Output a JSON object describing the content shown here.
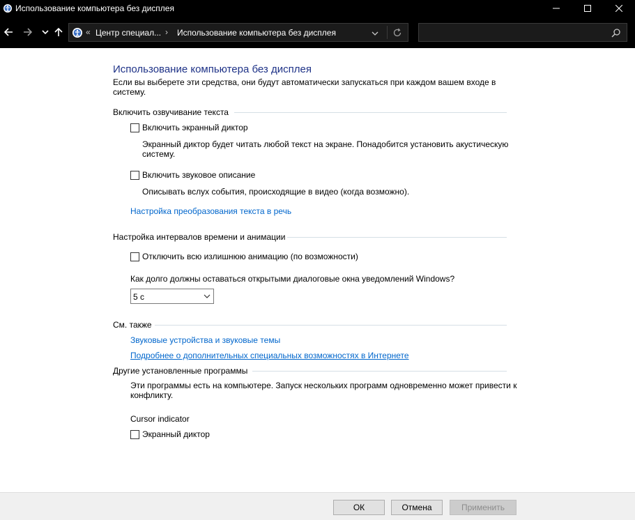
{
  "window": {
    "title": "Использование компьютера без дисплея"
  },
  "address": {
    "prefix": "«",
    "crumb1": "Центр специал...",
    "arrow": "›",
    "crumb2": "Использование компьютера без дисплея",
    "search_placeholder": ""
  },
  "main": {
    "title": "Использование компьютера без дисплея",
    "intro": "Если вы выберете эти средства, они будут автоматически запускаться при каждом вашем входе в систему.",
    "sections": {
      "speech": {
        "label": "Включить озвучивание текста",
        "narrator_label": "Включить экранный диктор",
        "narrator_desc": "Экранный диктор будет читать любой текст на экране. Понадобится установить акустическую систему.",
        "audio_desc_label": "Включить звуковое описание",
        "audio_desc_desc": "Описывать вслух события, происходящие в видео (когда возможно).",
        "tts_link": "Настройка преобразования текста в речь"
      },
      "timing": {
        "label": "Настройка интервалов времени и анимации",
        "animation_label": "Отключить всю излишнюю анимацию (по возможности)",
        "notify_question": "Как долго должны оставаться открытыми диалоговые окна уведомлений Windows?",
        "notify_value": "5 с"
      },
      "see_also": {
        "label": "См. также",
        "link1": "Звуковые устройства и звуковые темы",
        "link2": "Подробнее о дополнительных специальных возможностях в Интернете"
      },
      "other": {
        "label": "Другие установленные программы",
        "desc": "Эти программы есть на компьютере. Запуск нескольких программ одновременно может привести к конфликту.",
        "program_name": "Cursor indicator",
        "narrator_label": "Экранный диктор"
      }
    }
  },
  "footer": {
    "ok": "ОК",
    "cancel": "Отмена",
    "apply": "Применить"
  }
}
